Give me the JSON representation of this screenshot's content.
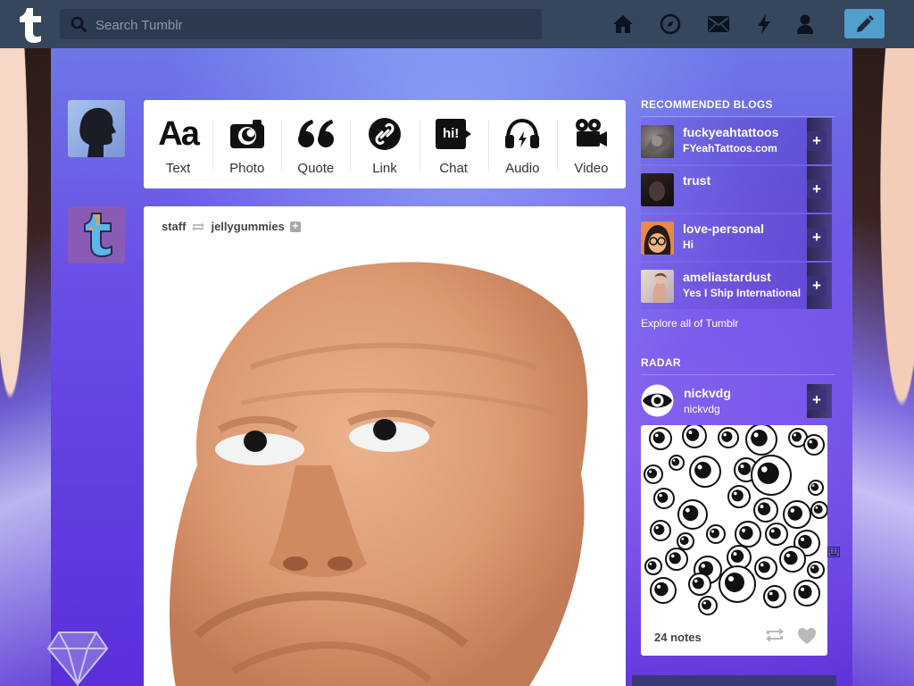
{
  "search": {
    "placeholder": "Search Tumblr"
  },
  "nav": {
    "icons": [
      "home-icon",
      "explore-icon",
      "inbox-icon",
      "activity-icon",
      "account-icon"
    ],
    "compose_icon": "pencil-icon",
    "colors": {
      "bar": "#36465d",
      "compose": "#529ecc"
    }
  },
  "post_types": [
    {
      "label": "Text",
      "icon": "text-icon"
    },
    {
      "label": "Photo",
      "icon": "camera-icon"
    },
    {
      "label": "Quote",
      "icon": "quote-icon"
    },
    {
      "label": "Link",
      "icon": "link-icon"
    },
    {
      "label": "Chat",
      "icon": "chat-icon"
    },
    {
      "label": "Audio",
      "icon": "headphones-icon"
    },
    {
      "label": "Video",
      "icon": "video-camera-icon"
    }
  ],
  "post_type_glyphs": {
    "text": "Aa",
    "quote": "“",
    "chat": "hi!"
  },
  "post": {
    "author": "staff",
    "reblogged_from": "jellygummies",
    "follow_glyph": "+"
  },
  "sidebar": {
    "recommended_title": "RECOMMENDED BLOGS",
    "blogs": [
      {
        "name": "fuckyeahtattoos",
        "subtitle": "FYeahTattoos.com"
      },
      {
        "name": "trust",
        "subtitle": ""
      },
      {
        "name": "love-personal",
        "subtitle": "Hi"
      },
      {
        "name": "ameliastardust",
        "subtitle": "Yes I Ship International"
      }
    ],
    "follow_glyph": "+",
    "explore_link": "Explore all of Tumblr",
    "radar_title": "RADAR",
    "radar": {
      "name": "nickvdg",
      "subtitle": "nickvdg",
      "notes": "24 notes"
    }
  }
}
